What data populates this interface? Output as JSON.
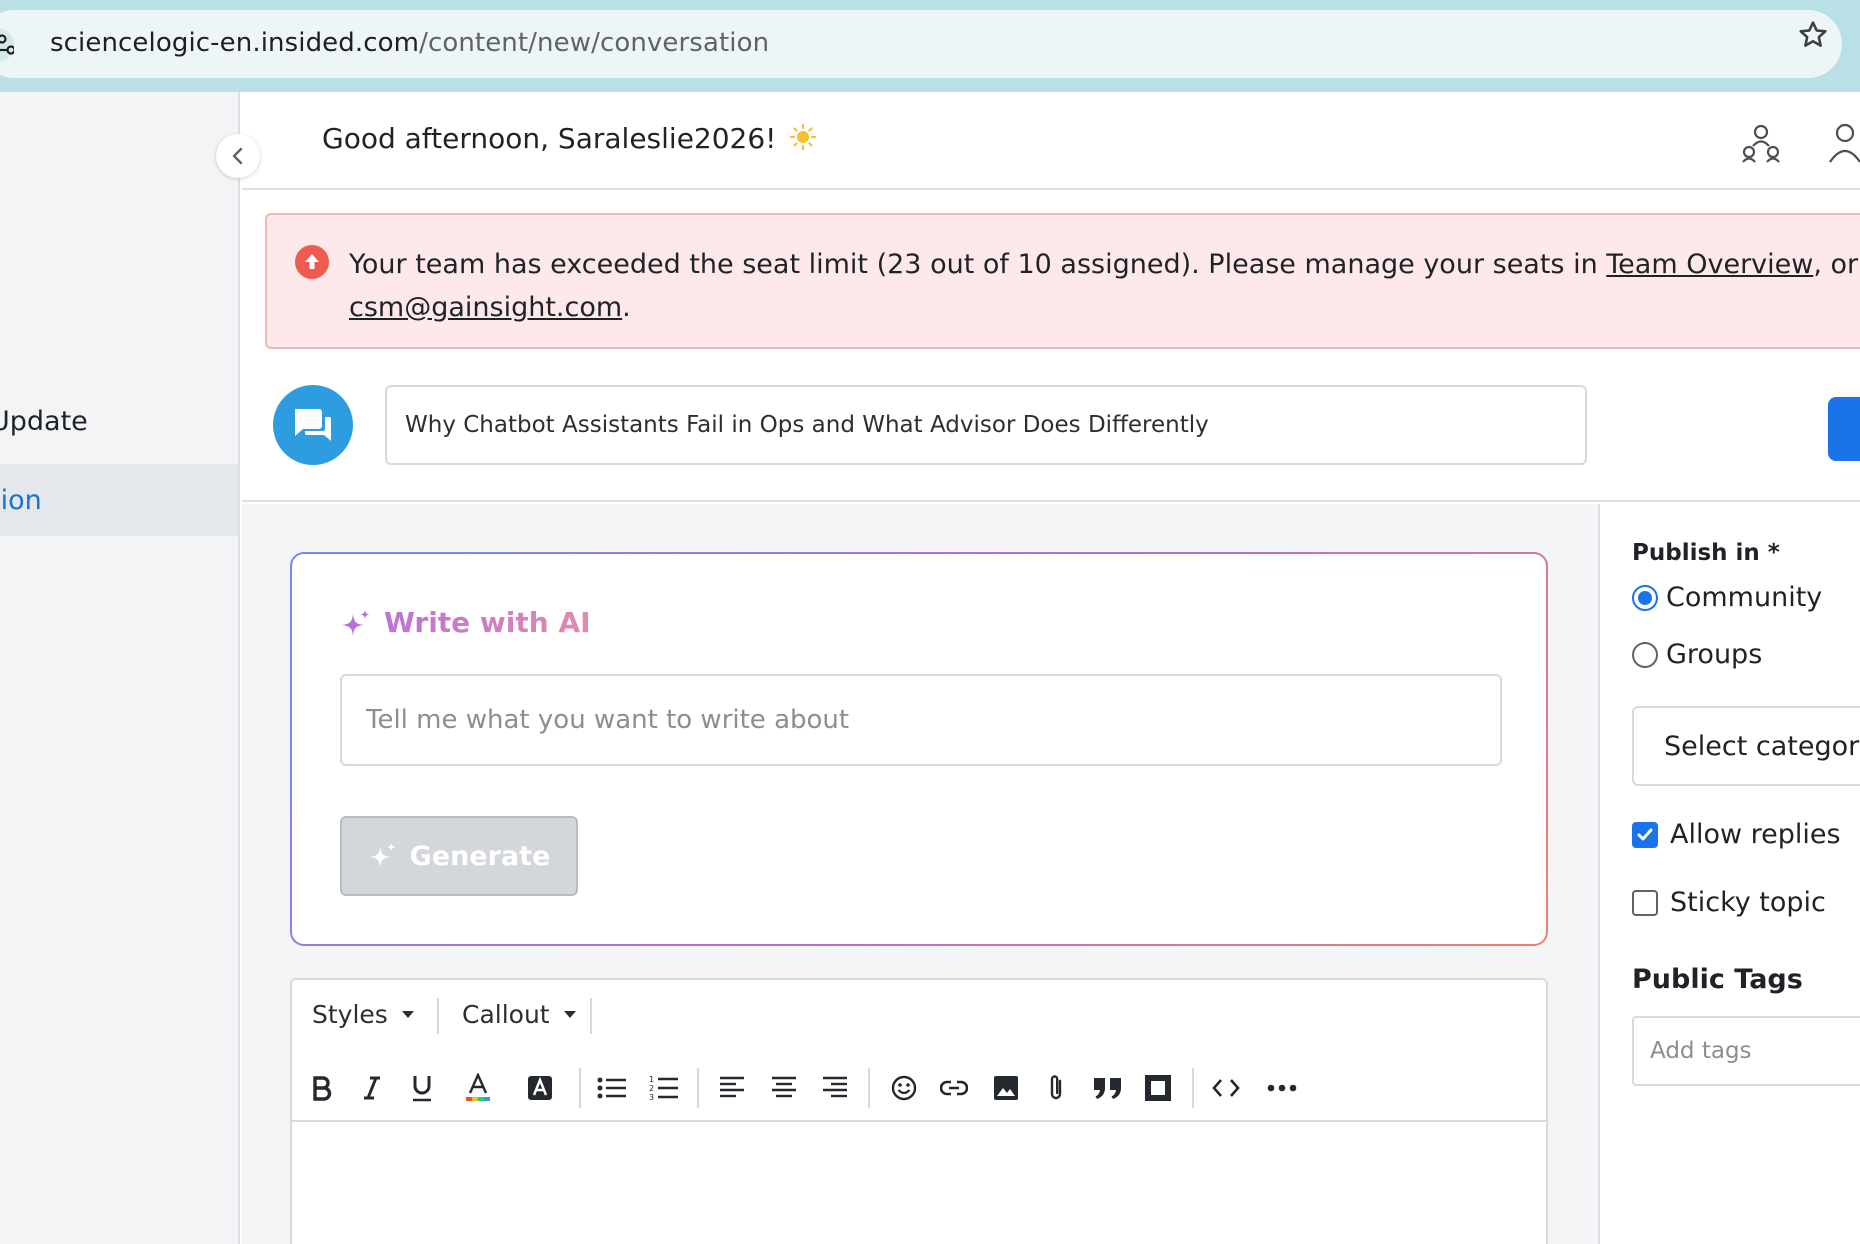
{
  "browser": {
    "url_host": "sciencelogic-en.insided.com",
    "url_path": "/content/new/conversation"
  },
  "sidebar": {
    "items": [
      {
        "label": "Update"
      },
      {
        "label": "tion"
      }
    ]
  },
  "header": {
    "greeting": "Good afternoon, Saraleslie2026!"
  },
  "alert": {
    "text_before": "Your team has exceeded the seat limit (23 out of 10 assigned). Please manage your seats in ",
    "link_team": "Team Overview",
    "text_mid": ", or ema",
    "email": "csm@gainsight.com",
    "text_end": "."
  },
  "title": {
    "value": "Why Chatbot Assistants Fail in Ops and What Advisor Does Differently"
  },
  "ai": {
    "title": "Write with AI",
    "placeholder": "Tell me what you want to write about",
    "generate_label": "Generate"
  },
  "editor": {
    "styles_label": "Styles",
    "callout_label": "Callout"
  },
  "publish": {
    "label": "Publish in *",
    "options": [
      {
        "label": "Community",
        "selected": true
      },
      {
        "label": "Groups",
        "selected": false
      }
    ],
    "category_placeholder": "Select category"
  },
  "settings": {
    "allow_replies": {
      "label": "Allow replies",
      "checked": true
    },
    "sticky_topic": {
      "label": "Sticky topic",
      "checked": false
    }
  },
  "tags": {
    "label": "Public Tags",
    "placeholder": "Add tags"
  },
  "colors": {
    "accent": "#1a73e8",
    "avatar": "#2d9ddf",
    "alert_bg": "#fde9e9",
    "alert_icon": "#ef5b50"
  }
}
